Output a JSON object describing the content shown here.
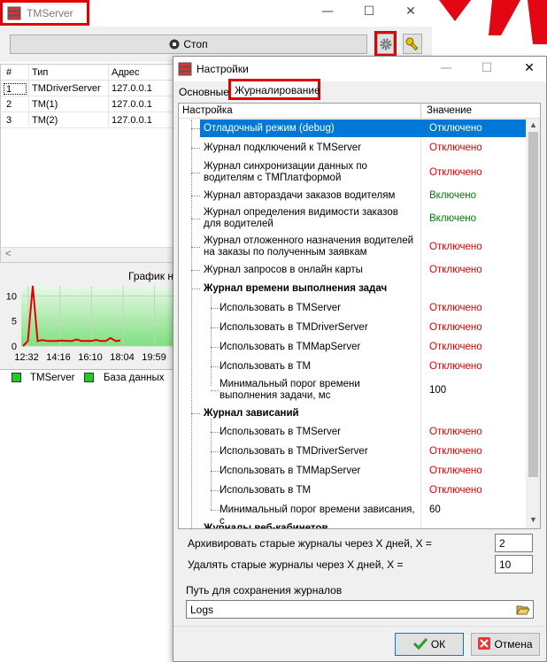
{
  "main_window": {
    "title": "TMServer",
    "stop_button": "Стоп",
    "min_glyph": "—",
    "max_glyph": "☐",
    "close_glyph": "✕"
  },
  "clients_table": {
    "headers": [
      "#",
      "Тип",
      "Адрес"
    ],
    "rows": [
      {
        "num": "1",
        "type": "TMDriverServer",
        "address": "127.0.0.1"
      },
      {
        "num": "2",
        "type": "TM(1)",
        "address": "127.0.0.1"
      },
      {
        "num": "3",
        "type": "TM(2)",
        "address": "127.0.0.1"
      }
    ]
  },
  "chart_data": {
    "type": "line",
    "title": "График н",
    "x_ticks": [
      "12:32",
      "14:16",
      "16:10",
      "18:04",
      "19:59"
    ],
    "y_ticks": [
      "10",
      "5",
      "0"
    ],
    "ylim": [
      0,
      12
    ],
    "series": [
      {
        "name": "TMServer",
        "color": "#e00000",
        "values": [
          0,
          1,
          12,
          1,
          1.2,
          1,
          1,
          1,
          1.1,
          1,
          1,
          1.3,
          1,
          1,
          1,
          1.2,
          1,
          1,
          1.6,
          1,
          1.1
        ]
      }
    ],
    "legend": [
      "TMServer",
      "База данных"
    ],
    "legend_color": "#22cc22"
  },
  "dialog": {
    "title": "Настройки",
    "tabs": [
      {
        "label": "Основные",
        "active": false
      },
      {
        "label": "Журналирование",
        "active": true
      }
    ],
    "grid_headers": {
      "name": "Настройка",
      "value": "Значение"
    },
    "rows": [
      {
        "name": "Отладочный режим (debug)",
        "value": "Отключено",
        "state": "off",
        "level": 0,
        "selected": true
      },
      {
        "name": "Журнал подключений к TMServer",
        "value": "Отключено",
        "state": "off",
        "level": 0
      },
      {
        "name": "Журнал синхронизации данных по водителям с ТМПлатформой",
        "value": "Отключено",
        "state": "off",
        "level": 0
      },
      {
        "name": "Журнал автораздачи заказов водителям",
        "value": "Включено",
        "state": "on",
        "level": 0
      },
      {
        "name": "Журнал определения видимости заказов для водителей",
        "value": "Включено",
        "state": "on",
        "level": 0
      },
      {
        "name": "Журнал отложенного назначения водителей на заказы по полученным заявкам",
        "value": "Отключено",
        "state": "off",
        "level": 0
      },
      {
        "name": "Журнал запросов в онлайн карты",
        "value": "Отключено",
        "state": "off",
        "level": 0
      },
      {
        "name": "Журнал времени выполнения задач",
        "value": "",
        "state": "group",
        "level": 0
      },
      {
        "name": "Использовать в TMServer",
        "value": "Отключено",
        "state": "off",
        "level": 1
      },
      {
        "name": "Использовать в TMDriverServer",
        "value": "Отключено",
        "state": "off",
        "level": 1
      },
      {
        "name": "Использовать в TMMapServer",
        "value": "Отключено",
        "state": "off",
        "level": 1
      },
      {
        "name": "Использовать в ТМ",
        "value": "Отключено",
        "state": "off",
        "level": 1
      },
      {
        "name": "Минимальный порог времени выполнения задачи, мс",
        "value": "100",
        "state": "num",
        "level": 1
      },
      {
        "name": "Журнал зависаний",
        "value": "",
        "state": "group",
        "level": 0
      },
      {
        "name": "Использовать в TMServer",
        "value": "Отключено",
        "state": "off",
        "level": 1
      },
      {
        "name": "Использовать в TMDriverServer",
        "value": "Отключено",
        "state": "off",
        "level": 1
      },
      {
        "name": "Использовать в TMMapServer",
        "value": "Отключено",
        "state": "off",
        "level": 1
      },
      {
        "name": "Использовать в ТМ",
        "value": "Отключено",
        "state": "off",
        "level": 1
      },
      {
        "name": "Минимальный порог времени зависания, с",
        "value": "60",
        "state": "num",
        "level": 1
      },
      {
        "name": "Журналы веб-кабинетов",
        "value": "",
        "state": "group",
        "level": 0
      }
    ],
    "archive_label": "Архивировать старые журналы через X дней, X =",
    "archive_value": "2",
    "delete_label": "Удалять старые журналы через X дней, X =",
    "delete_value": "10",
    "path_label": "Путь для сохранения журналов",
    "path_value": "Logs",
    "ok_button": "ОК",
    "cancel_button": "Отмена"
  },
  "colors": {
    "selection": "#0078d7",
    "highlight_frame": "#e00000",
    "enabled": "#008000",
    "disabled": "#e00000"
  }
}
